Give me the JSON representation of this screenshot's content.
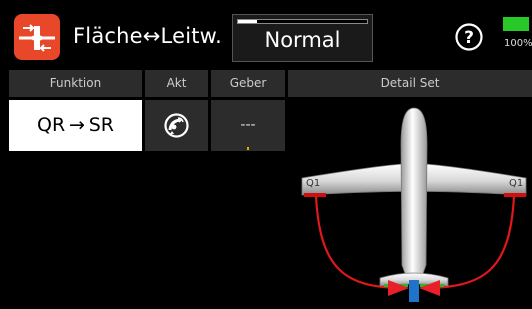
{
  "header": {
    "title": "Fläche↔Leitw.",
    "mode": "Normal",
    "mode_progress": 0.15,
    "app_icon": "wing-mixer-icon",
    "help_icon": "help-icon",
    "battery_percent": "100%",
    "battery_color": "#28c828"
  },
  "table": {
    "columns": {
      "funktion": "Funktion",
      "akt": "Akt",
      "geber": "Geber",
      "detail": "Detail Set"
    },
    "row": {
      "funktion": "QR → SR",
      "akt_icon": "satellite-dish-icon",
      "geber": "---"
    }
  },
  "diagram": {
    "left_aileron_label": "Q1",
    "right_aileron_label": "Q1",
    "wire_color": "#e01818",
    "servo_color": "#d01010",
    "tail_color": "#1e74c8",
    "arrow_color": "#e8202a",
    "arrow_green": "#28b828"
  },
  "colors": {
    "accent": "#e8472a",
    "selected_row_bg": "#ffffff",
    "cell_bg": "#2c2c2c"
  }
}
